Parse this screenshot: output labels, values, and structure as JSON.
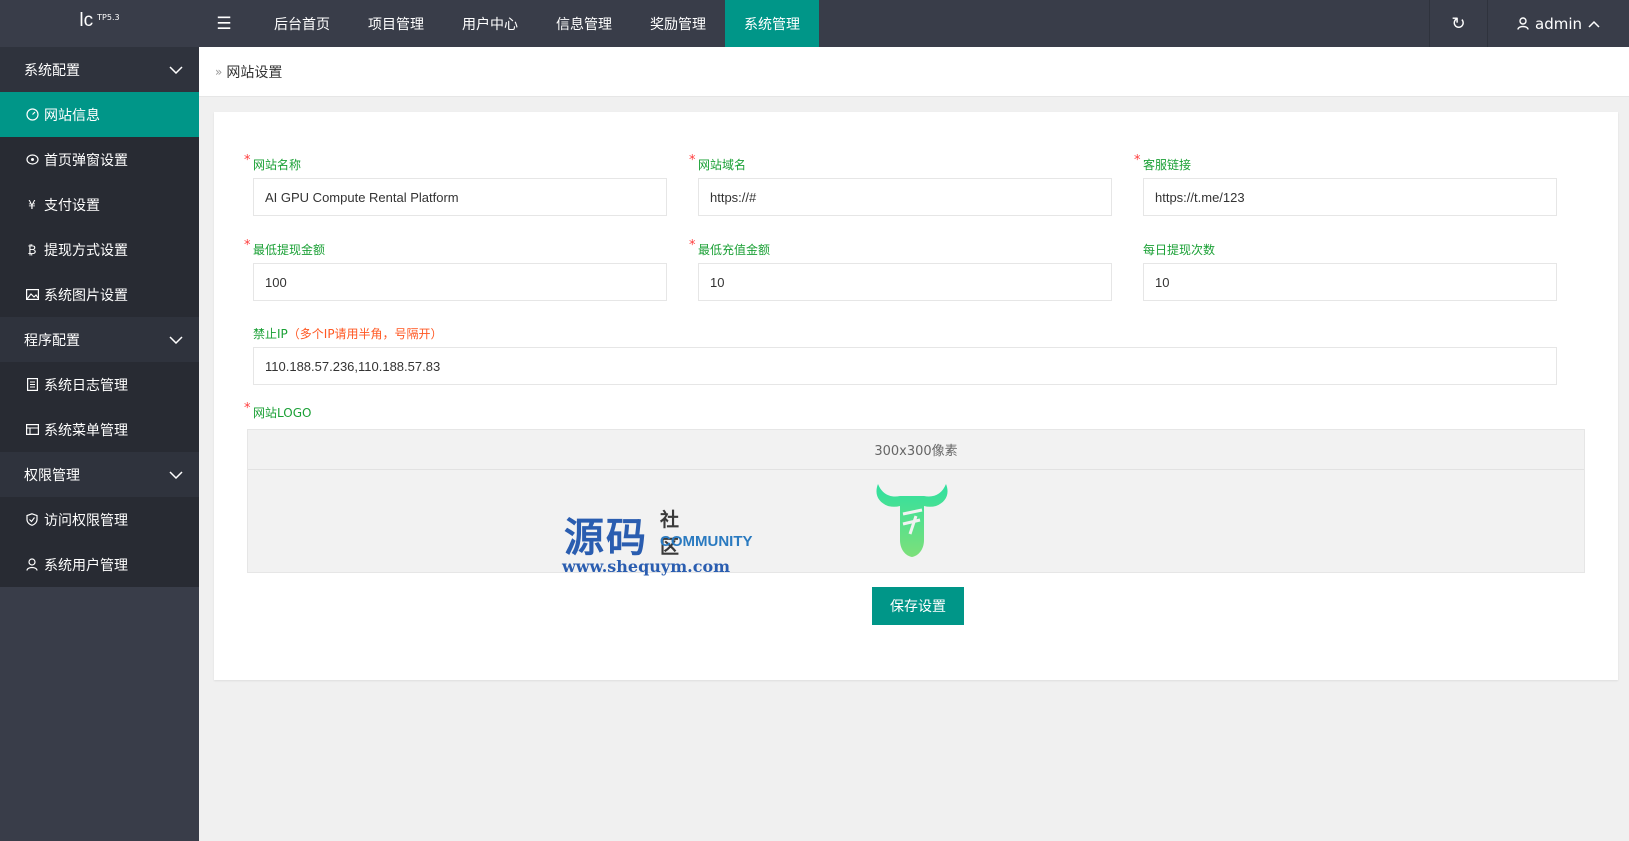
{
  "app": {
    "logo": "lc",
    "version": "TP5.3"
  },
  "nav": {
    "items": [
      {
        "label": "后台首页"
      },
      {
        "label": "项目管理"
      },
      {
        "label": "用户中心"
      },
      {
        "label": "信息管理"
      },
      {
        "label": "奖励管理"
      },
      {
        "label": "系统管理"
      }
    ],
    "active_index": 5
  },
  "header": {
    "user": "admin"
  },
  "sidebar": {
    "groups": [
      {
        "label": "系统配置",
        "items": [
          {
            "label": "网站信息",
            "icon": "gauge-icon",
            "active": true
          },
          {
            "label": "首页弹窗设置",
            "icon": "popup-icon"
          },
          {
            "label": "支付设置",
            "icon": "yen-icon"
          },
          {
            "label": "提现方式设置",
            "icon": "bitcoin-icon"
          },
          {
            "label": "系统图片设置",
            "icon": "image-icon"
          }
        ]
      },
      {
        "label": "程序配置",
        "items": [
          {
            "label": "系统日志管理",
            "icon": "log-icon"
          },
          {
            "label": "系统菜单管理",
            "icon": "menu-icon"
          }
        ]
      },
      {
        "label": "权限管理",
        "items": [
          {
            "label": "访问权限管理",
            "icon": "shield-icon"
          },
          {
            "label": "系统用户管理",
            "icon": "user-icon"
          }
        ]
      }
    ]
  },
  "breadcrumb": {
    "current": "网站设置"
  },
  "form": {
    "site_name": {
      "label": "网站名称",
      "value": "AI GPU Compute Rental Platform"
    },
    "site_domain": {
      "label": "网站域名",
      "value": "https://#"
    },
    "service_link": {
      "label": "客服链接",
      "value": "https://t.me/123"
    },
    "min_withdraw": {
      "label": "最低提现金额",
      "value": "100"
    },
    "min_recharge": {
      "label": "最低充值金额",
      "value": "10"
    },
    "daily_withdraw": {
      "label": "每日提现次数",
      "value": "10"
    },
    "ban_ip": {
      "label": "禁止IP",
      "tip": "（多个IP请用半角，号隔开）",
      "value": "110.188.57.236,110.188.57.83"
    },
    "logo": {
      "label": "网站LOGO",
      "size_hint": "300x300像素"
    },
    "save_label": "保存设置"
  },
  "watermark": {
    "big": "源码",
    "small": "社区",
    "community": "COMMUNITY",
    "url": "www.shequym.com"
  },
  "colors": {
    "accent": "#009688",
    "topbar": "#393d49",
    "label_green": "#1aa035",
    "required": "#ff3b3b",
    "logo_green": "#3ddc97"
  }
}
